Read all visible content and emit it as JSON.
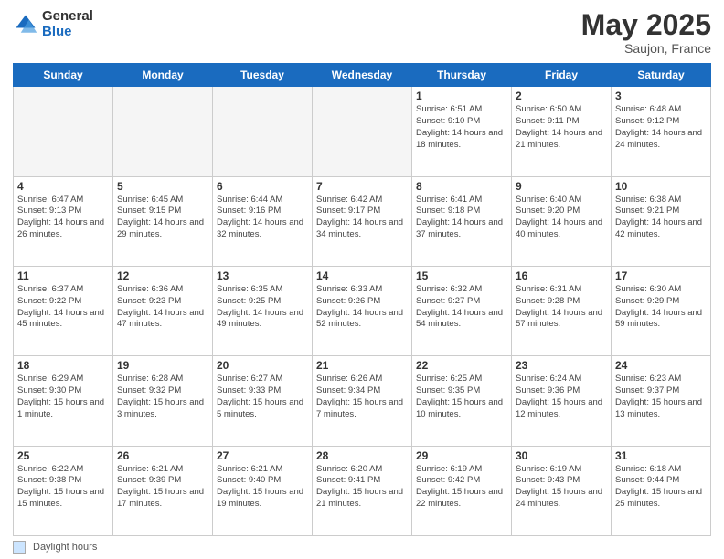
{
  "header": {
    "logo_general": "General",
    "logo_blue": "Blue",
    "title": "May 2025",
    "location": "Saujon, France"
  },
  "days_of_week": [
    "Sunday",
    "Monday",
    "Tuesday",
    "Wednesday",
    "Thursday",
    "Friday",
    "Saturday"
  ],
  "footer": {
    "legend_label": "Daylight hours"
  },
  "weeks": [
    [
      {
        "day": "",
        "info": ""
      },
      {
        "day": "",
        "info": ""
      },
      {
        "day": "",
        "info": ""
      },
      {
        "day": "",
        "info": ""
      },
      {
        "day": "1",
        "info": "Sunrise: 6:51 AM\nSunset: 9:10 PM\nDaylight: 14 hours\nand 18 minutes."
      },
      {
        "day": "2",
        "info": "Sunrise: 6:50 AM\nSunset: 9:11 PM\nDaylight: 14 hours\nand 21 minutes."
      },
      {
        "day": "3",
        "info": "Sunrise: 6:48 AM\nSunset: 9:12 PM\nDaylight: 14 hours\nand 24 minutes."
      }
    ],
    [
      {
        "day": "4",
        "info": "Sunrise: 6:47 AM\nSunset: 9:13 PM\nDaylight: 14 hours\nand 26 minutes."
      },
      {
        "day": "5",
        "info": "Sunrise: 6:45 AM\nSunset: 9:15 PM\nDaylight: 14 hours\nand 29 minutes."
      },
      {
        "day": "6",
        "info": "Sunrise: 6:44 AM\nSunset: 9:16 PM\nDaylight: 14 hours\nand 32 minutes."
      },
      {
        "day": "7",
        "info": "Sunrise: 6:42 AM\nSunset: 9:17 PM\nDaylight: 14 hours\nand 34 minutes."
      },
      {
        "day": "8",
        "info": "Sunrise: 6:41 AM\nSunset: 9:18 PM\nDaylight: 14 hours\nand 37 minutes."
      },
      {
        "day": "9",
        "info": "Sunrise: 6:40 AM\nSunset: 9:20 PM\nDaylight: 14 hours\nand 40 minutes."
      },
      {
        "day": "10",
        "info": "Sunrise: 6:38 AM\nSunset: 9:21 PM\nDaylight: 14 hours\nand 42 minutes."
      }
    ],
    [
      {
        "day": "11",
        "info": "Sunrise: 6:37 AM\nSunset: 9:22 PM\nDaylight: 14 hours\nand 45 minutes."
      },
      {
        "day": "12",
        "info": "Sunrise: 6:36 AM\nSunset: 9:23 PM\nDaylight: 14 hours\nand 47 minutes."
      },
      {
        "day": "13",
        "info": "Sunrise: 6:35 AM\nSunset: 9:25 PM\nDaylight: 14 hours\nand 49 minutes."
      },
      {
        "day": "14",
        "info": "Sunrise: 6:33 AM\nSunset: 9:26 PM\nDaylight: 14 hours\nand 52 minutes."
      },
      {
        "day": "15",
        "info": "Sunrise: 6:32 AM\nSunset: 9:27 PM\nDaylight: 14 hours\nand 54 minutes."
      },
      {
        "day": "16",
        "info": "Sunrise: 6:31 AM\nSunset: 9:28 PM\nDaylight: 14 hours\nand 57 minutes."
      },
      {
        "day": "17",
        "info": "Sunrise: 6:30 AM\nSunset: 9:29 PM\nDaylight: 14 hours\nand 59 minutes."
      }
    ],
    [
      {
        "day": "18",
        "info": "Sunrise: 6:29 AM\nSunset: 9:30 PM\nDaylight: 15 hours\nand 1 minute."
      },
      {
        "day": "19",
        "info": "Sunrise: 6:28 AM\nSunset: 9:32 PM\nDaylight: 15 hours\nand 3 minutes."
      },
      {
        "day": "20",
        "info": "Sunrise: 6:27 AM\nSunset: 9:33 PM\nDaylight: 15 hours\nand 5 minutes."
      },
      {
        "day": "21",
        "info": "Sunrise: 6:26 AM\nSunset: 9:34 PM\nDaylight: 15 hours\nand 7 minutes."
      },
      {
        "day": "22",
        "info": "Sunrise: 6:25 AM\nSunset: 9:35 PM\nDaylight: 15 hours\nand 10 minutes."
      },
      {
        "day": "23",
        "info": "Sunrise: 6:24 AM\nSunset: 9:36 PM\nDaylight: 15 hours\nand 12 minutes."
      },
      {
        "day": "24",
        "info": "Sunrise: 6:23 AM\nSunset: 9:37 PM\nDaylight: 15 hours\nand 13 minutes."
      }
    ],
    [
      {
        "day": "25",
        "info": "Sunrise: 6:22 AM\nSunset: 9:38 PM\nDaylight: 15 hours\nand 15 minutes."
      },
      {
        "day": "26",
        "info": "Sunrise: 6:21 AM\nSunset: 9:39 PM\nDaylight: 15 hours\nand 17 minutes."
      },
      {
        "day": "27",
        "info": "Sunrise: 6:21 AM\nSunset: 9:40 PM\nDaylight: 15 hours\nand 19 minutes."
      },
      {
        "day": "28",
        "info": "Sunrise: 6:20 AM\nSunset: 9:41 PM\nDaylight: 15 hours\nand 21 minutes."
      },
      {
        "day": "29",
        "info": "Sunrise: 6:19 AM\nSunset: 9:42 PM\nDaylight: 15 hours\nand 22 minutes."
      },
      {
        "day": "30",
        "info": "Sunrise: 6:19 AM\nSunset: 9:43 PM\nDaylight: 15 hours\nand 24 minutes."
      },
      {
        "day": "31",
        "info": "Sunrise: 6:18 AM\nSunset: 9:44 PM\nDaylight: 15 hours\nand 25 minutes."
      }
    ]
  ]
}
